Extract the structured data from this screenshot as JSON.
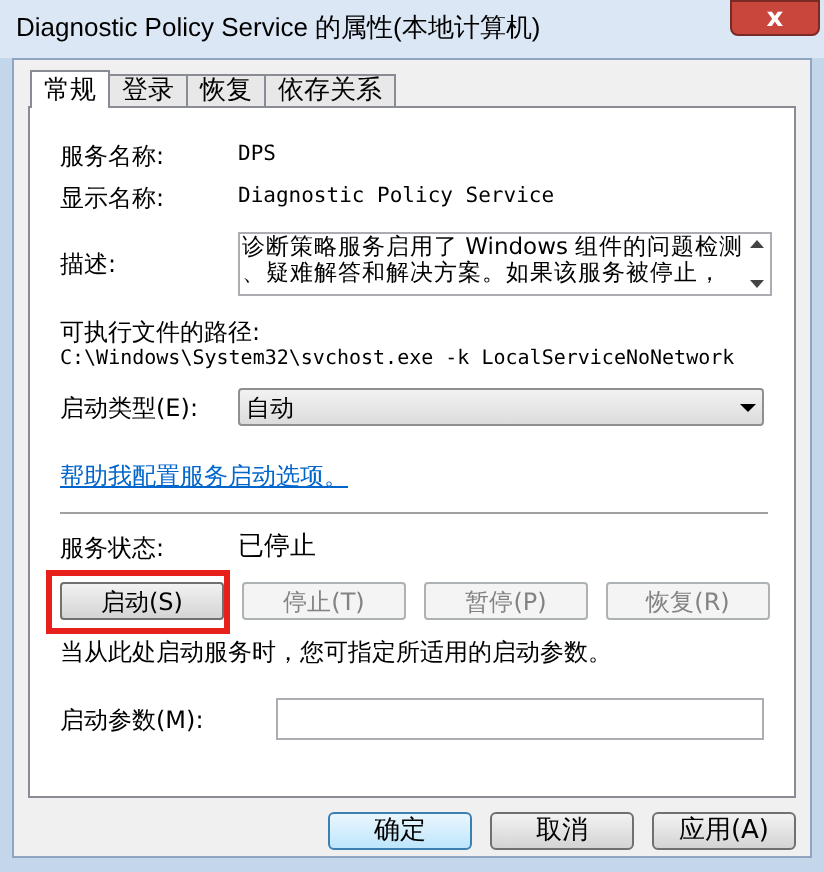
{
  "window": {
    "title": "Diagnostic Policy Service 的属性(本地计算机)",
    "close": "x"
  },
  "tabs": [
    {
      "label": "常规",
      "selected": true
    },
    {
      "label": "登录",
      "selected": false
    },
    {
      "label": "恢复",
      "selected": false
    },
    {
      "label": "依存关系",
      "selected": false
    }
  ],
  "service_name": {
    "label": "服务名称:",
    "value": "DPS"
  },
  "display_name": {
    "label": "显示名称:",
    "value": "Diagnostic Policy Service"
  },
  "description": {
    "label": "描述:",
    "lines": [
      "诊断策略服务启用了 Windows 组件的问题检测",
      "、疑难解答和解决方案。如果该服务被停止，"
    ]
  },
  "executable_path": {
    "label": "可执行文件的路径:",
    "value": "C:\\Windows\\System32\\svchost.exe -k LocalServiceNoNetwork"
  },
  "startup_type": {
    "label": "启动类型(E):",
    "value": "自动"
  },
  "help_link": "帮助我配置服务启动选项。",
  "service_status": {
    "label": "服务状态:",
    "value": "已停止"
  },
  "service_buttons": [
    {
      "label": "启动(S)",
      "disabled": false,
      "highlighted": true
    },
    {
      "label": "停止(T)",
      "disabled": true,
      "highlighted": false
    },
    {
      "label": "暂停(P)",
      "disabled": true,
      "highlighted": false
    },
    {
      "label": "恢复(R)",
      "disabled": true,
      "highlighted": false
    }
  ],
  "hint": "当从此处启动服务时，您可指定所适用的启动参数。",
  "start_parameters": {
    "label": "启动参数(M):"
  },
  "dialog_buttons": [
    {
      "label": "确定",
      "default": true
    },
    {
      "label": "取消",
      "default": false
    },
    {
      "label": "应用(A)",
      "default": false
    }
  ]
}
